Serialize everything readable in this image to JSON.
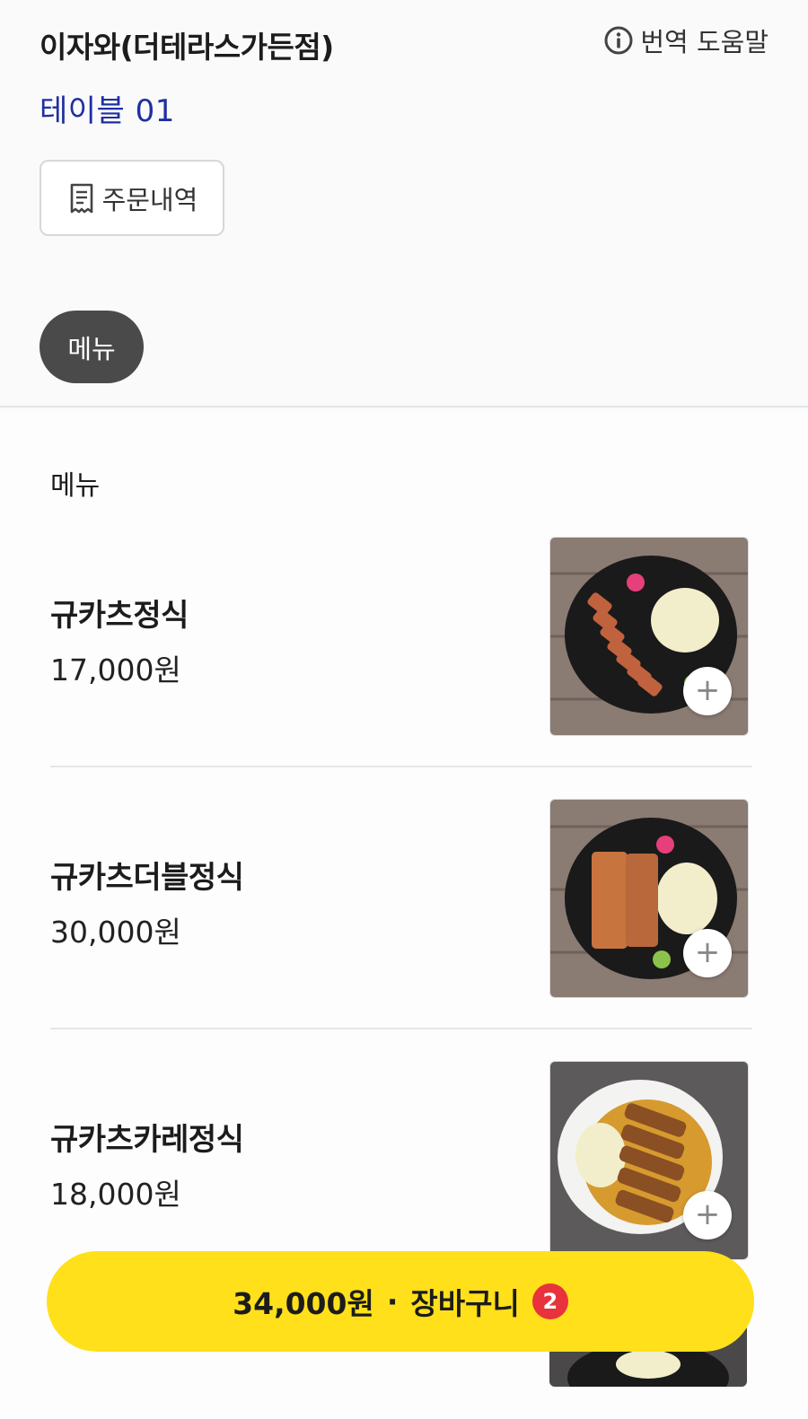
{
  "header": {
    "store_name": "이자와(더테라스가든점)",
    "help_label": "번역 도움말",
    "table_name": "테이블 01",
    "order_history_label": "주문내역"
  },
  "category_tabs": [
    {
      "label": "메뉴",
      "selected": true
    }
  ],
  "section": {
    "title": "메뉴"
  },
  "menu_items": [
    {
      "name": "규카츠정식",
      "price": "17,000원"
    },
    {
      "name": "규카츠더블정식",
      "price": "30,000원"
    },
    {
      "name": "규카츠카레정식",
      "price": "18,000원"
    }
  ],
  "cart": {
    "total": "34,000원",
    "separator": "·",
    "label": "장바구니",
    "count": "2"
  },
  "colors": {
    "accent_yellow": "#ffe01a",
    "table_blue": "#1f2fa3",
    "badge_red": "#e8323c",
    "chip_dark": "#4a4a4a"
  },
  "icons": {
    "help": "info-circle-icon",
    "order_history": "receipt-icon",
    "add": "plus-icon"
  }
}
